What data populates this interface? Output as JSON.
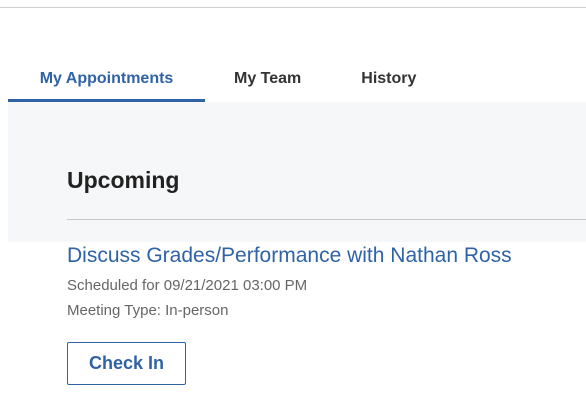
{
  "tabs": [
    {
      "label": "My Appointments",
      "active": true
    },
    {
      "label": "My Team",
      "active": false
    },
    {
      "label": "History",
      "active": false
    }
  ],
  "upcoming": {
    "heading": "Upcoming",
    "appointment": {
      "title": "Discuss Grades/Performance with Nathan Ross",
      "scheduled": "Scheduled for 09/21/2021 03:00 PM",
      "meeting_type": "Meeting Type: In-person",
      "check_in_label": "Check In"
    }
  },
  "colors": {
    "accent": "#2f63a6",
    "panel_bg": "#f5f7f9",
    "text_dark": "#222222",
    "text_muted": "#666666"
  }
}
